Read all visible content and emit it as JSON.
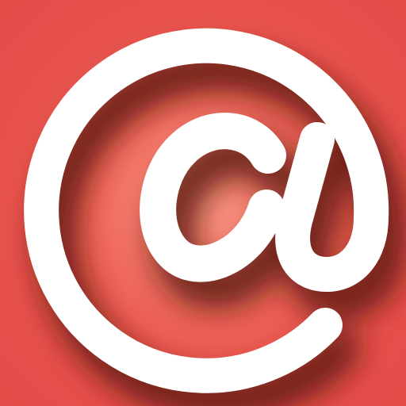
{
  "icon": {
    "name": "at-sign-icon",
    "glyph": "@",
    "background_color": "#e6504b",
    "glyph_color": "#ffffff",
    "shadow_color": "#5a1410"
  }
}
